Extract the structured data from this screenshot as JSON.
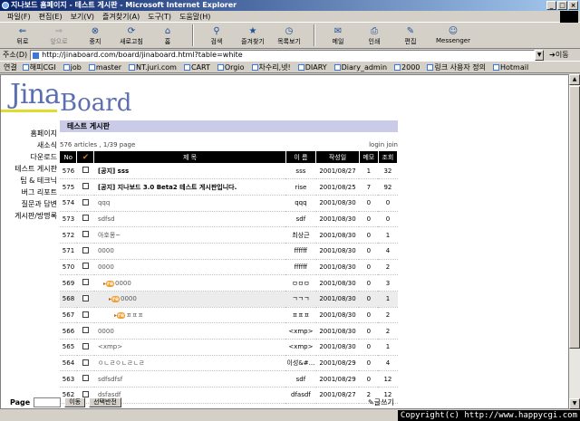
{
  "window": {
    "title": "지나보드 홈페이지 - 테스트 게시판 - Microsoft Internet Explorer",
    "buttons": [
      "_",
      "□",
      "×"
    ]
  },
  "menu": [
    "파일(F)",
    "편집(E)",
    "보기(V)",
    "즐겨찾기(A)",
    "도구(T)",
    "도움말(H)"
  ],
  "toolbar": {
    "back": "뒤로",
    "forward": "앞으로",
    "stop": "중지",
    "refresh": "새로고침",
    "home": "홈",
    "search": "검색",
    "favorites": "즐겨찾기",
    "history": "목록보기",
    "mail": "메일",
    "print": "인쇄",
    "edit": "편집",
    "messenger": "Messenger"
  },
  "address": {
    "label": "주소(D)",
    "url": "http://jinaboard.com/board/jinaboard.html?table=white",
    "go": "이동"
  },
  "links": {
    "label": "연결",
    "items": [
      "해피CGI",
      "job",
      "master",
      "NT.juri.com",
      "CART",
      "Orgio",
      "차수리,넷!",
      "DIARY",
      "Diary_admin",
      "2000",
      "링크 사용자 정의",
      "Hotmail"
    ]
  },
  "logo": {
    "part1": "Jina",
    "part2": "Board"
  },
  "sidenav": [
    "홈페이지",
    "새소식",
    "다운로드",
    "테스트 게시판",
    "팁 & 테크닉",
    "버그 리포트",
    "질문과 답변",
    "게시판/방명록"
  ],
  "board": {
    "title": "테스트 게시판",
    "info": "576 articles , 1/39 page",
    "login": "login join",
    "headers": [
      "No",
      "✔",
      "제 목",
      "이 름",
      "작성일",
      "메모",
      "조회"
    ],
    "rows": [
      {
        "no": "576",
        "subject": "[공지] sss",
        "bold": true,
        "reply": 0,
        "name": "sss",
        "date": "2001/08/27",
        "memo": "1",
        "hits": "32"
      },
      {
        "no": "575",
        "subject": "[공지] 지나보드 3.0 Beta2 테스트 게시판입니다.",
        "bold": true,
        "reply": 0,
        "name": "rise",
        "date": "2001/08/25",
        "memo": "7",
        "hits": "92"
      },
      {
        "no": "574",
        "subject": "qqq",
        "bold": false,
        "reply": 0,
        "name": "qqq",
        "date": "2001/08/30",
        "memo": "0",
        "hits": "0"
      },
      {
        "no": "573",
        "subject": "sdfsd",
        "bold": false,
        "reply": 0,
        "name": "sdf",
        "date": "2001/08/30",
        "memo": "0",
        "hits": "0"
      },
      {
        "no": "572",
        "subject": "아호몽~",
        "bold": false,
        "reply": 0,
        "name": "최상근",
        "date": "2001/08/30",
        "memo": "0",
        "hits": "1"
      },
      {
        "no": "571",
        "subject": "0000",
        "bold": false,
        "reply": 0,
        "name": "ffffff",
        "date": "2001/08/30",
        "memo": "0",
        "hits": "4"
      },
      {
        "no": "570",
        "subject": "0000",
        "bold": false,
        "reply": 0,
        "name": "ffffff",
        "date": "2001/08/30",
        "memo": "0",
        "hits": "2"
      },
      {
        "no": "569",
        "subject": "0000",
        "bold": false,
        "reply": 1,
        "name": "ㅁㅁㅁ",
        "date": "2001/08/30",
        "memo": "0",
        "hits": "3"
      },
      {
        "no": "568",
        "subject": "0000",
        "bold": false,
        "reply": 2,
        "name": "ㄱㄱㄱ",
        "date": "2001/08/30",
        "memo": "0",
        "hits": "1",
        "selected": true
      },
      {
        "no": "567",
        "subject": "ㅍㅍㅍ",
        "bold": false,
        "reply": 3,
        "name": "ㅍㅍㅍ",
        "date": "2001/08/30",
        "memo": "0",
        "hits": "2"
      },
      {
        "no": "566",
        "subject": "0000",
        "bold": false,
        "reply": 0,
        "name": "<xmp>",
        "date": "2001/08/30",
        "memo": "0",
        "hits": "2"
      },
      {
        "no": "565",
        "subject": "<xmp>",
        "bold": false,
        "reply": 0,
        "name": "<xmp>",
        "date": "2001/08/30",
        "memo": "0",
        "hits": "1"
      },
      {
        "no": "564",
        "subject": "ㅇㄴㄹㅇㄴㄹㄴㄹ",
        "bold": false,
        "reply": 0,
        "name": "이성&#...",
        "date": "2001/08/29",
        "memo": "0",
        "hits": "4"
      },
      {
        "no": "563",
        "subject": "sdfsdfsf",
        "bold": false,
        "reply": 0,
        "name": "sdf",
        "date": "2001/08/29",
        "memo": "0",
        "hits": "12"
      },
      {
        "no": "562",
        "subject": "dsfasdf",
        "bold": false,
        "reply": 0,
        "name": "dfasdf",
        "date": "2001/08/27",
        "memo": "2",
        "hits": "12"
      }
    ],
    "page_label": "Page",
    "move_label": "이동",
    "select_label": "선택반전",
    "write_label": "글쓰기"
  },
  "copyright": "Copyright(c) http://www.happycgi.com"
}
